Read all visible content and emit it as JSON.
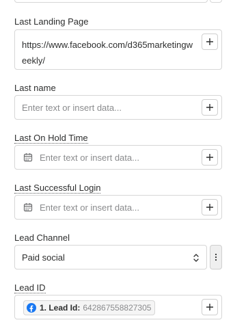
{
  "fields": {
    "last_landing_page": {
      "label": "Last Landing Page",
      "value_line1": "https://www.facebook.com/d365marketingw",
      "value_line2": "eekly/"
    },
    "last_name": {
      "label": "Last name",
      "placeholder": "Enter text or insert data..."
    },
    "last_on_hold_time": {
      "label": "Last On Hold Time",
      "placeholder": "Enter text or insert data..."
    },
    "last_successful_login": {
      "label": "Last Successful Login",
      "placeholder": "Enter text or insert data..."
    },
    "lead_channel": {
      "label": "Lead Channel",
      "selected": "Paid social"
    },
    "lead_id": {
      "label": "Lead ID",
      "chip_step": "1. Lead Id:",
      "chip_value": "642867558827305"
    }
  },
  "icons": {
    "add": "plus-icon",
    "date": "calendar-icon",
    "select": "chevron-up-down-icon",
    "more": "kebab-icon",
    "source_app": "facebook-icon"
  },
  "colors": {
    "border": "#d6d6d6",
    "placeholder": "#8a8b8d",
    "text": "#2d2e2e",
    "facebook": "#1877f2"
  }
}
